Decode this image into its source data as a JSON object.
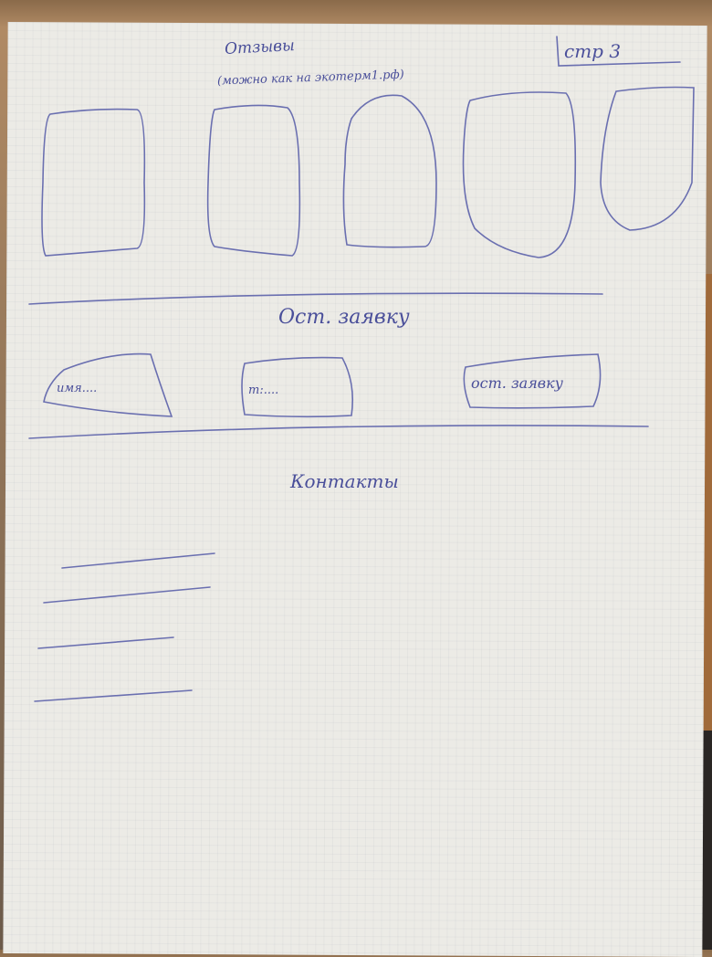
{
  "page_label": "стр 3",
  "reviews": {
    "title": "Отзывы",
    "note": "(можно как на экотерм1.рф)",
    "card_count": 5
  },
  "request": {
    "title": "Ост. заявку",
    "name_field": "имя....",
    "phone_field": "т:....",
    "submit_button": "ост. заявку"
  },
  "contacts": {
    "title": "Контакты",
    "line_count": 4
  },
  "colors": {
    "ink": "#4a4f9a",
    "paper": "#ecebe6"
  }
}
